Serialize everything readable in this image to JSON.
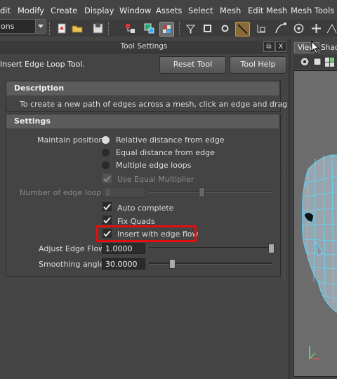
{
  "menubar": {
    "items": [
      "dit",
      "Modify",
      "Create",
      "Display",
      "Window",
      "Assets",
      "Select",
      "Mesh",
      "Edit Mesh",
      "Mesh Tools"
    ]
  },
  "toolbar": {
    "mode_value": "ons"
  },
  "tool_settings": {
    "title": "Tool Settings",
    "tool_name": "Insert Edge Loop Tool.",
    "reset_label": "Reset Tool",
    "help_label": "Tool Help",
    "float_button": "⧉",
    "close_button": "X",
    "description": {
      "header": "Description",
      "text": "To create a new path of edges across a mesh, click an edge and drag."
    },
    "settings": {
      "header": "Settings",
      "maintain_label": "Maintain position:",
      "radio_relative": "Relative distance from edge",
      "radio_equal": "Equal distance from edge",
      "radio_multiple": "Multiple edge loops",
      "selected_radio": "Relative distance from edge",
      "use_equal_multiplier": "Use Equal Multiplier",
      "num_loops_label": "Number of edge loops:",
      "num_loops_value": "2",
      "auto_complete": "Auto complete",
      "fix_quads": "Fix Quads",
      "insert_edge_flow": "Insert with edge flow",
      "adjust_label": "Adjust Edge Flow",
      "adjust_value": "1.0000",
      "adjust_level": 1.0,
      "smoothing_label": "Smoothing angle:",
      "smoothing_value": "30.0000",
      "smoothing_level": 0.17,
      "num_loops_level": 0.42
    }
  },
  "viewport": {
    "tab_view": "View",
    "tab_shading": "Shad"
  },
  "colors": {
    "highlight": "#e01010",
    "mesh_wire": "#5fd8ff",
    "mesh_fill": "#9aa4ad"
  }
}
